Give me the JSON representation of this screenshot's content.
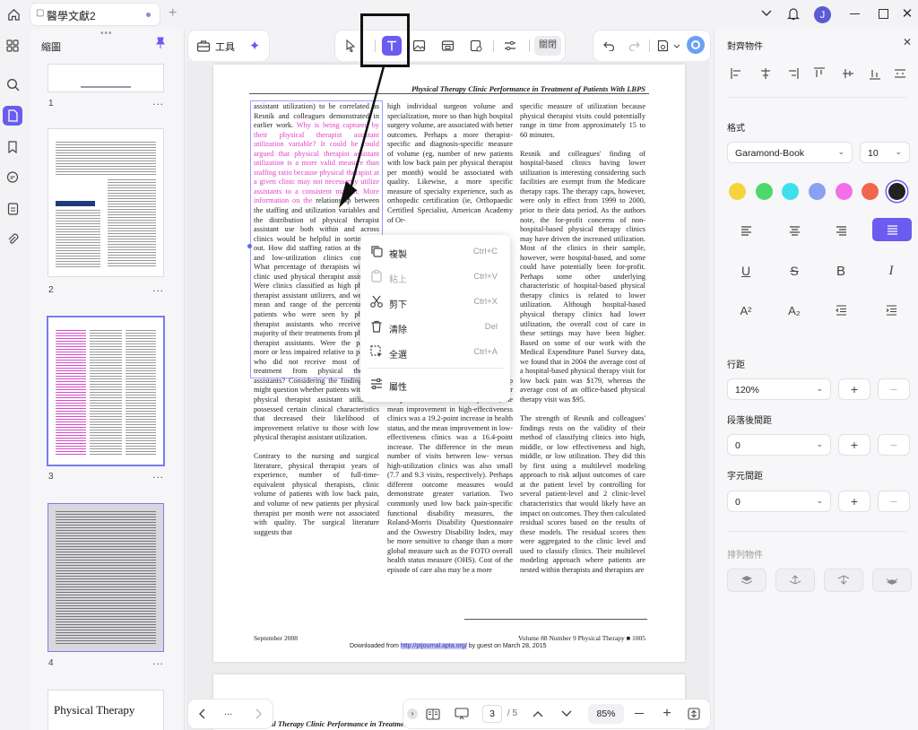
{
  "titlebar": {
    "tab_title": "醫學文獻2",
    "new_tab": "+",
    "avatar_initial": "J"
  },
  "thumbnails": {
    "title": "縮圖",
    "pages": [
      {
        "num": "1",
        "more": "..."
      },
      {
        "num": "2",
        "more": "..."
      },
      {
        "num": "3",
        "more": "..."
      },
      {
        "num": "4",
        "more": "..."
      }
    ],
    "page5_title": "Physical Therapy"
  },
  "toolbar": {
    "tools_label": "工具",
    "close_label": "關閉"
  },
  "document": {
    "running_head": "Physical Therapy Clinic Performance in Treatment of Patients With LBPS",
    "col1a": "assistant utilization) to be correlated as Resnik and colleagues demonstrated in earlier work.",
    "col1_pink": "Why is being captured by their physical therapist assistant utilization variable? It could be could argued that physical therapist assistant utilization is a more valid measure than staffing ratio because physical therapist at a given clinic may not necessarily utilize assistants to a consistent manner. More information on the",
    "col1b": "relationship between the staffing and utilization variables and the distribution of physical therapist assistant use both within and across clinics would be helpful in sorting this out. How did staffing ratios at the high and low-utilization clinics compare? What percentage of therapists within a clinic used physical therapist assistants? Were clinics classified as high physical therapist assistant utilizers, and were the mean and range of the percentage of patients who were seen by physical therapist assistants who received the majority of their treatments from physical therapist assistants. Were the patients more or less impaired relative to patients who did not receive most of their treatment from physical therapist assistants? Considering the findings, we might question whether patients with high physical therapist assistant utilization possessed certain clinical characteristics that decreased their likelihood of improvement relative to those with low physical therapist assistant utilization.",
    "col1c": "Contrary to the nursing and surgical literature, physical therapist years of experience, number of full-time-equivalent physical therapists, clinic volume of patients with low back pain, and volume of new patients per physical therapist per month were not associated with quality. The surgical literature suggests that",
    "col2a": "high individual surgeon volume and specialization, more so than high hospital surgery volume, are associated with better outcomes. Perhaps a more therapist-specific and diagnosis-specific measure of volume (eg, number of new patients with low back pain per physical therapist per month) would be associated with quality. Likewise, a more specific measure of specialty experience, such as orthopedic certification (ie, Orthopaedic Certified Specialist, American Academy of Or-",
    "col2b": "not have been sensitive enough to pick up some of the associations with their independent variables. As they noted, the mean improvement in high-effectiveness clinics was a 19.2-point increase in health status, and the mean improvement in low-effectiveness clinics was a 16.4-point increase. The difference in the mean number of visits between low- versus high-utilization clinics was also small (7.7 and 9.3 visits, respectively). Perhaps different outcome measures would demonstrate greater variation. Two commonly used low back pain-specific functional disability measures, the Roland-Morris Disability Questionnaire and the Oswestry Disability Index, may be more sensitive to change than a more global measure such as the FOTO overall health status measure (OHS). Cost of the episode of care also may be a more",
    "col3a": "specific measure of utilization because physical therapist visits could potentially range in time from approximately 15 to 60 minutes.",
    "col3b": "Resnik and colleagues' finding of hospital-based clinics having lower utilization is interesting considering such facilities are exempt from the Medicare therapy caps. The therapy caps, however, were only in effect from 1999 to 2000, prior to their data period. As the authors note, the for-profit concerns of non-hospital-based physical therapy clinics may have driven the increased utilization. Most of the clinics in their sample, however, were hospital-based, and some could have potentially been for-profit. Perhaps some other underlying characteristic of hospital-based physical therapy clinics is related to lower utilization. Although hospital-based physical therapy clinics had lower utilization, the overall cost of care in these settings may have been higher. Based on some of our work with the Medical Expenditure Panel Survey data, we found that in 2004 the average cost of a hospital-based physical therapy visit for low back pain was $179, whereas the average cost of an office-based physical therapy visit was $95.",
    "col3c": "The strength of Resnik and colleagues' findings rests on the validity of their method of classifying clinics into high, middle, or low effectiveness and high, middle, or low utilization. They did this by first using a multilevel modeling approach to risk adjust outcomes of care at the patient level by controlling for several patient-level and 2 clinic-level characteristics that would likely have an impact on outcomes. They then calculated residual scores based on the results of these models. The residual scores then were aggregated to the clinic level and used to classify clinics. Their multilevel modeling approach where patients are nested within therapists and therapists are",
    "footer_left": "September 2008",
    "footer_right": "Volume 88 Number 9 Physical Therapy ■ 1005",
    "download_pre": "Downloaded from ",
    "download_link": "http://ptjournal.apta.org/",
    "download_post": " by guest on March 28, 2015",
    "next_page_head": "Physical Therapy Clinic Performance in Treatment of Patients With LBPS"
  },
  "context_menu": {
    "items": [
      {
        "label": "複製",
        "shortcut": "Ctrl+C",
        "icon": "copy-icon"
      },
      {
        "label": "粘上",
        "shortcut": "Ctrl+V",
        "icon": "paste-icon"
      },
      {
        "label": "剪下",
        "shortcut": "Ctrl+X",
        "icon": "scissors-icon"
      },
      {
        "label": "清除",
        "shortcut": "Del",
        "icon": "trash-icon"
      },
      {
        "label": "全選",
        "shortcut": "Ctrl+A",
        "icon": "select-all-icon"
      },
      {
        "label": "屬性",
        "shortcut": "",
        "icon": "properties-icon"
      }
    ]
  },
  "bottombar": {
    "current_page": "3",
    "total_pages": "/ 5",
    "zoom": "85%",
    "more": "..."
  },
  "rightpanel": {
    "align_title": "對齊物件",
    "format_title": "格式",
    "font": "Garamond-Book",
    "font_size": "10",
    "colors": [
      "#f5d33d",
      "#4ed86a",
      "#3ee0ee",
      "#8aa0f2",
      "#f46ee8",
      "#f2664e",
      "#222222"
    ],
    "line_spacing_label": "行距",
    "line_spacing": "120%",
    "para_spacing_label": "段落後間距",
    "para_spacing": "0",
    "char_spacing_label": "字元間距",
    "char_spacing": "0",
    "arrange_title": "排列物件",
    "plus": "+",
    "minus": "−"
  }
}
